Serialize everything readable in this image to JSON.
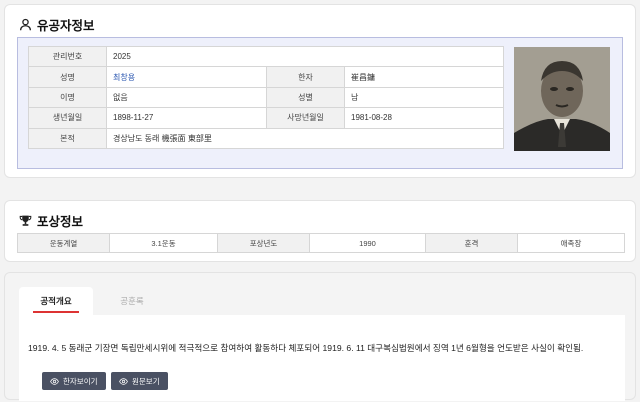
{
  "personal": {
    "title": "유공자정보",
    "rows": [
      {
        "l1": "관리번호",
        "v1": "2025",
        "l2": "",
        "v2": ""
      },
      {
        "l1": "성명",
        "v1": "최창용",
        "l2": "한자",
        "v2": "崔昌鏞"
      },
      {
        "l1": "이명",
        "v1": "없음",
        "l2": "성별",
        "v2": "남"
      },
      {
        "l1": "생년월일",
        "v1": "1898-11-27",
        "l2": "사망년월일",
        "v2": "1981-08-28"
      },
      {
        "l1": "본적",
        "v1": "경상남도 동래 機張面 東部里",
        "l2": "",
        "v2": ""
      }
    ]
  },
  "award": {
    "title": "포상정보",
    "cells": [
      "운동계열",
      "3.1운동",
      "포상년도",
      "1990",
      "훈격",
      "애족장"
    ]
  },
  "merit": {
    "tab_active": "공적개요",
    "tab_inactive": "공훈록",
    "description": "1919. 4. 5 동래군 기장면 독립만세시위에 적극적으로 참여하여 활동하다 체포되어 1919. 6. 11 대구복심법원에서 징역 1년 6월형을 언도받은 사실이 확인됨.",
    "btn_hanja": "한자보이기",
    "btn_original": "원문보기"
  }
}
